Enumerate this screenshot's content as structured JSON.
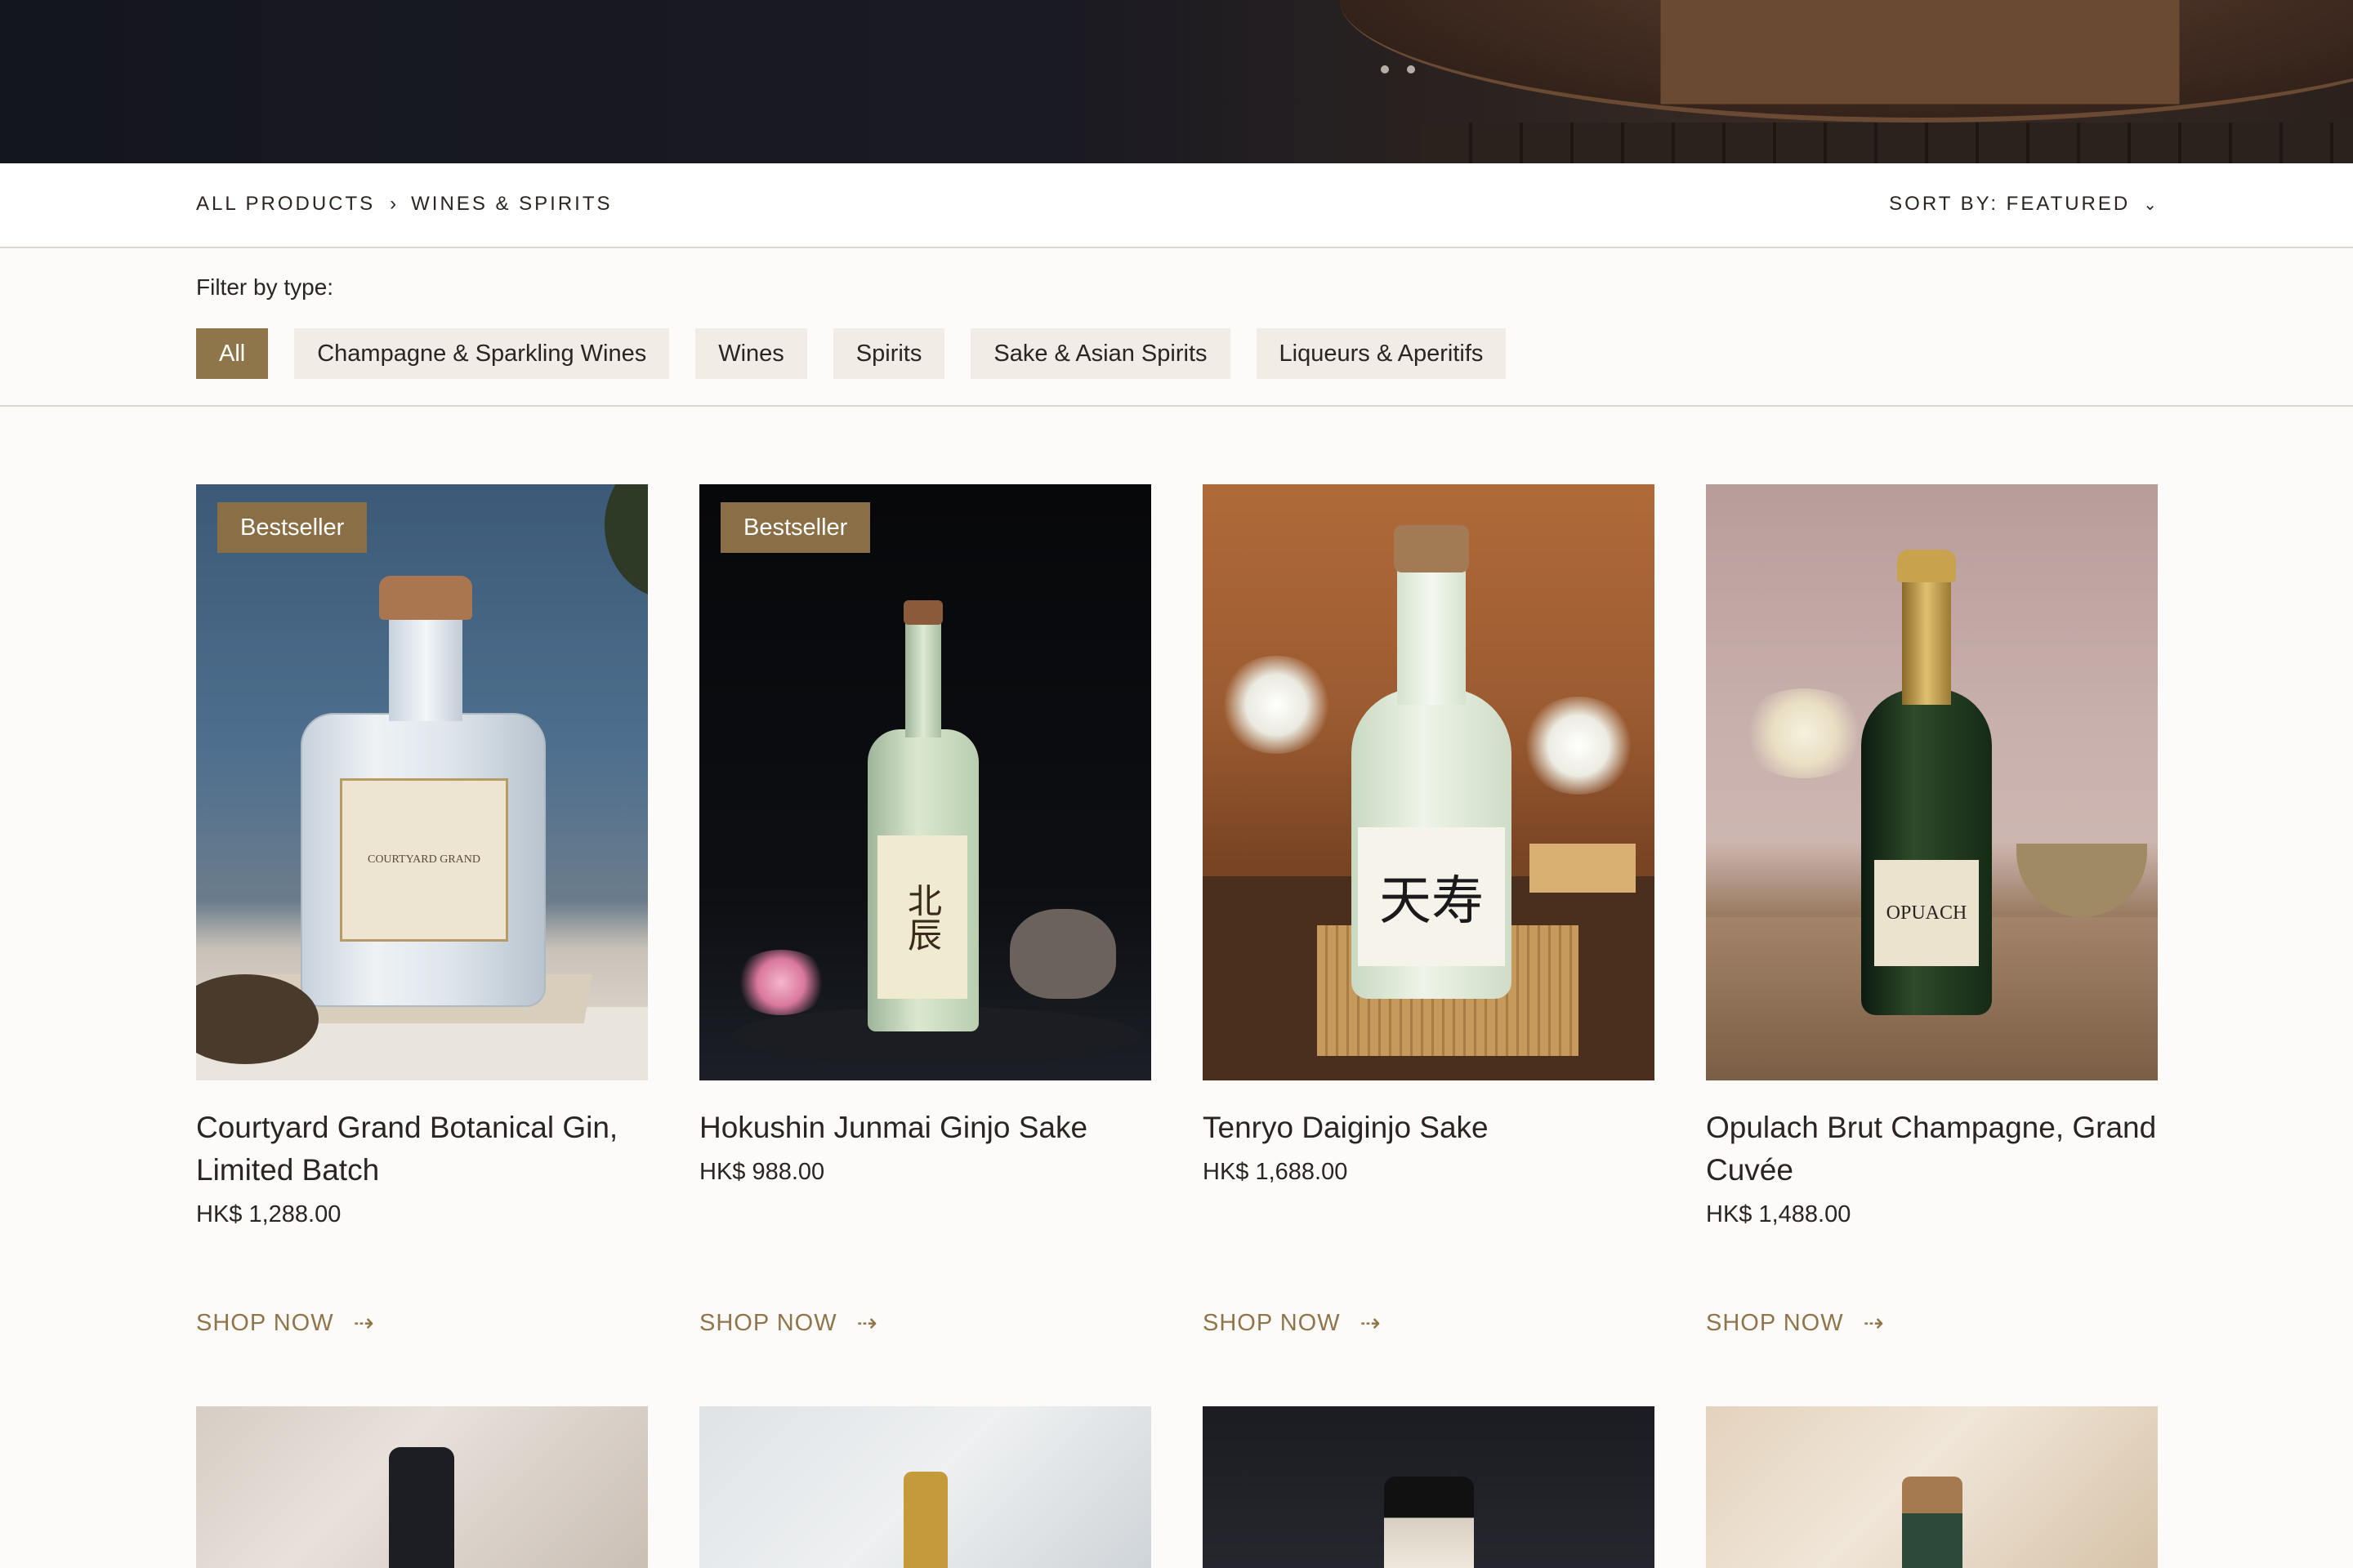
{
  "breadcrumb": {
    "root": "ALL PRODUCTS",
    "separator": "›",
    "current": "WINES & SPIRITS"
  },
  "sort": {
    "label": "SORT BY: FEATURED",
    "icon": "chevron-down-icon"
  },
  "filter": {
    "label": "Filter by type:",
    "chips": [
      "All",
      "Champagne & Sparkling Wines",
      "Wines",
      "Spirits",
      "Sake & Asian Spirits",
      "Liqueurs & Aperitifs"
    ],
    "active": "All"
  },
  "products": [
    {
      "badge": "Bestseller",
      "name": "Courtyard Grand Botanical Gin, Limited Batch",
      "price": "HK$ 1,288.00",
      "cta": "SHOP NOW",
      "bottle_label": "COURTYARD GRAND"
    },
    {
      "badge": "Bestseller",
      "name": "Hokushin Junmai Ginjo Sake",
      "price": "HK$ 988.00",
      "cta": "SHOP NOW",
      "bottle_label": "北辰"
    },
    {
      "badge": "",
      "name": "Tenryo Daiginjo Sake",
      "price": "HK$ 1,688.00",
      "cta": "SHOP NOW",
      "bottle_label": "天寿"
    },
    {
      "badge": "",
      "name": "Opulach Brut Champagne, Grand Cuvée",
      "price": "HK$ 1,488.00",
      "cta": "SHOP NOW",
      "bottle_label": "OPUACH"
    }
  ],
  "colors": {
    "accent": "#8f754a",
    "badge": "#8a6f46",
    "chip_bg": "#f1ece6",
    "page_bg": "#fdfbf9"
  }
}
